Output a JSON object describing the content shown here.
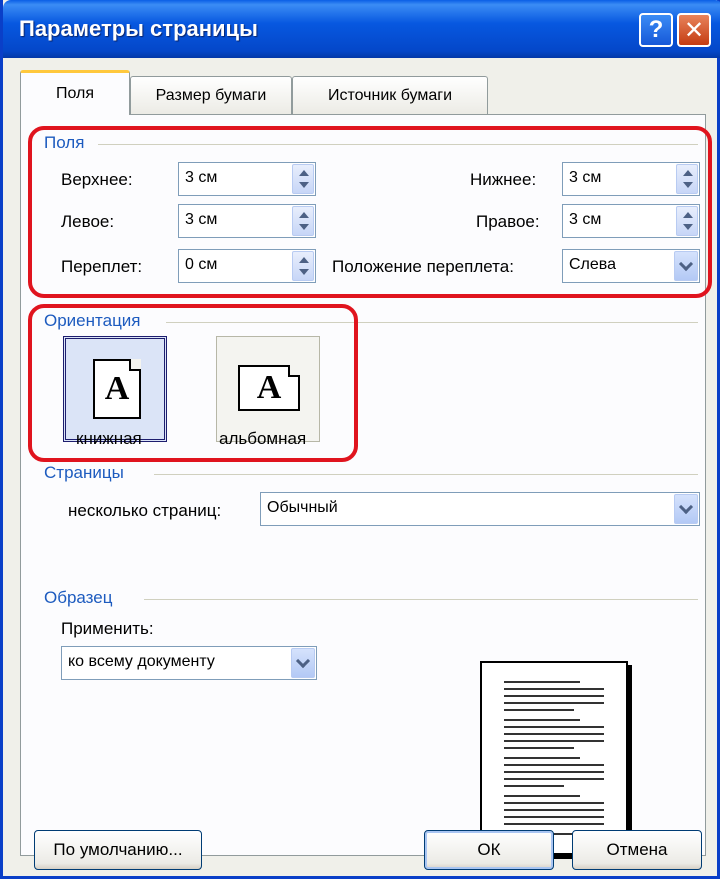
{
  "window": {
    "title": "Параметры страницы",
    "help_icon": "question-mark",
    "close_icon": "x-mark"
  },
  "tabs": [
    {
      "label": "Поля",
      "active": true
    },
    {
      "label": "Размер бумаги",
      "active": false
    },
    {
      "label": "Источник бумаги",
      "active": false
    }
  ],
  "margins": {
    "group_label": "Поля",
    "top": {
      "label": "Верхнее:",
      "value": "3 см"
    },
    "bottom": {
      "label": "Нижнее:",
      "value": "3 см"
    },
    "left": {
      "label": "Левое:",
      "value": "3 см"
    },
    "right": {
      "label": "Правое:",
      "value": "3 см"
    },
    "gutter": {
      "label": "Переплет:",
      "value": "0 см"
    },
    "gutter_position": {
      "label": "Положение переплета:",
      "value": "Слева"
    }
  },
  "orientation": {
    "group_label": "Ориентация",
    "portrait": {
      "label": "книжная",
      "glyph": "A",
      "selected": true
    },
    "landscape": {
      "label": "альбомная",
      "glyph": "A",
      "selected": false
    }
  },
  "pages": {
    "group_label": "Страницы",
    "multiple_label": "несколько страниц:",
    "multiple_value": "Обычный"
  },
  "preview": {
    "group_label": "Образец",
    "apply_label": "Применить:",
    "apply_value": "ко всему документу"
  },
  "buttons": {
    "default_label": "По умолчанию...",
    "ok_label": "ОК",
    "cancel_label": "Отмена"
  },
  "colors": {
    "titlebar": "#0758e0",
    "group_label": "#1d5bbf",
    "highlight": "#e0141e"
  }
}
